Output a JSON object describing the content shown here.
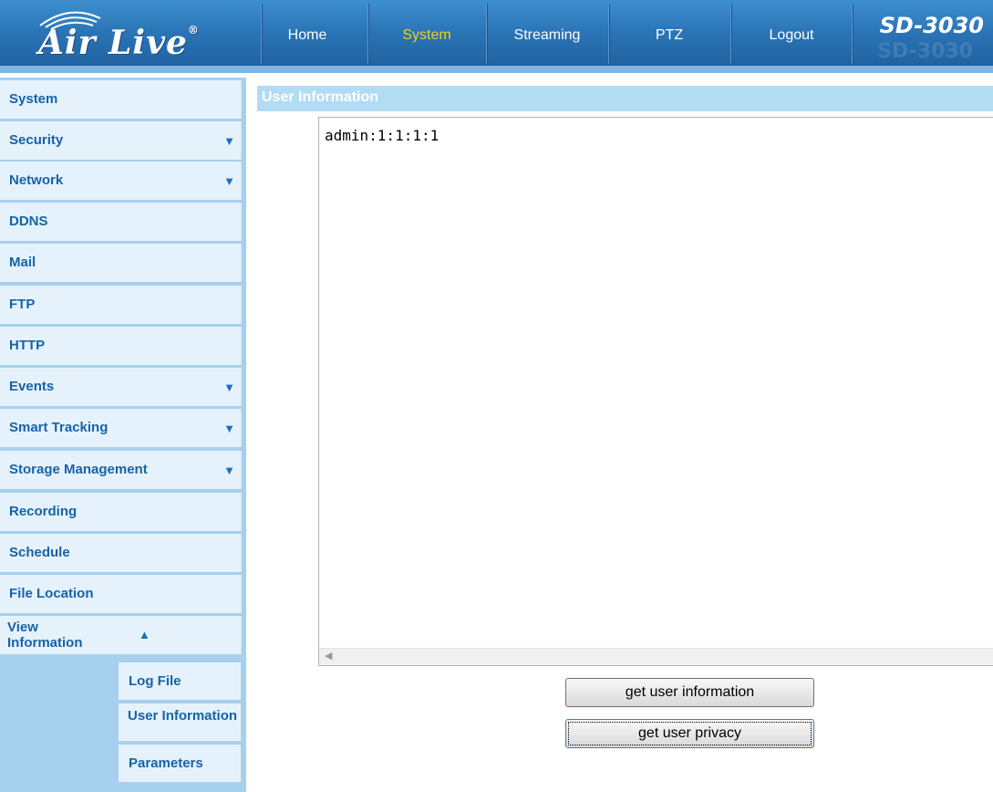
{
  "header": {
    "logo_text": "Air Live",
    "model": "SD-3030",
    "model_ghost": "SD-3030",
    "nav": [
      {
        "label": "Home",
        "active": false
      },
      {
        "label": "System",
        "active": true
      },
      {
        "label": "Streaming",
        "active": false
      },
      {
        "label": "PTZ",
        "active": false
      },
      {
        "label": "Logout",
        "active": false
      }
    ]
  },
  "sidebar": {
    "items": [
      {
        "label": "System",
        "expandable": false
      },
      {
        "label": "Security",
        "expandable": true,
        "indicator": "▼"
      },
      {
        "label": "Network",
        "expandable": true,
        "indicator": "▼"
      },
      {
        "label": "DDNS",
        "expandable": false
      },
      {
        "label": "Mail",
        "expandable": false
      },
      {
        "label": "FTP",
        "expandable": false
      },
      {
        "label": "HTTP",
        "expandable": false
      },
      {
        "label": "Events",
        "expandable": true,
        "indicator": "▼"
      },
      {
        "label": "Smart Tracking",
        "expandable": true,
        "indicator": "▼"
      },
      {
        "label": "Storage Management",
        "expandable": true,
        "indicator": "▼"
      },
      {
        "label": "Recording",
        "expandable": false
      },
      {
        "label": "Schedule",
        "expandable": false
      },
      {
        "label": "File Location",
        "expandable": false
      }
    ],
    "view_information": {
      "label": "View Information",
      "indicator": "▲",
      "subitems": [
        {
          "label": "Log File"
        },
        {
          "label": "User Information"
        },
        {
          "label": "Parameters"
        }
      ]
    }
  },
  "main": {
    "section_title": "User Information",
    "textbox_content": "admin:1:1:1:1",
    "buttons": {
      "get_user_information": "get user information",
      "get_user_privacy": "get user privacy"
    }
  },
  "colors": {
    "header_blue": "#2a74b6",
    "active_nav": "#f2d11b",
    "sidebar_bg": "#a6d0ee",
    "sidebar_item_bg": "#e6f2fb",
    "sidebar_text": "#1663a8",
    "section_bar": "#b2dbf4"
  }
}
